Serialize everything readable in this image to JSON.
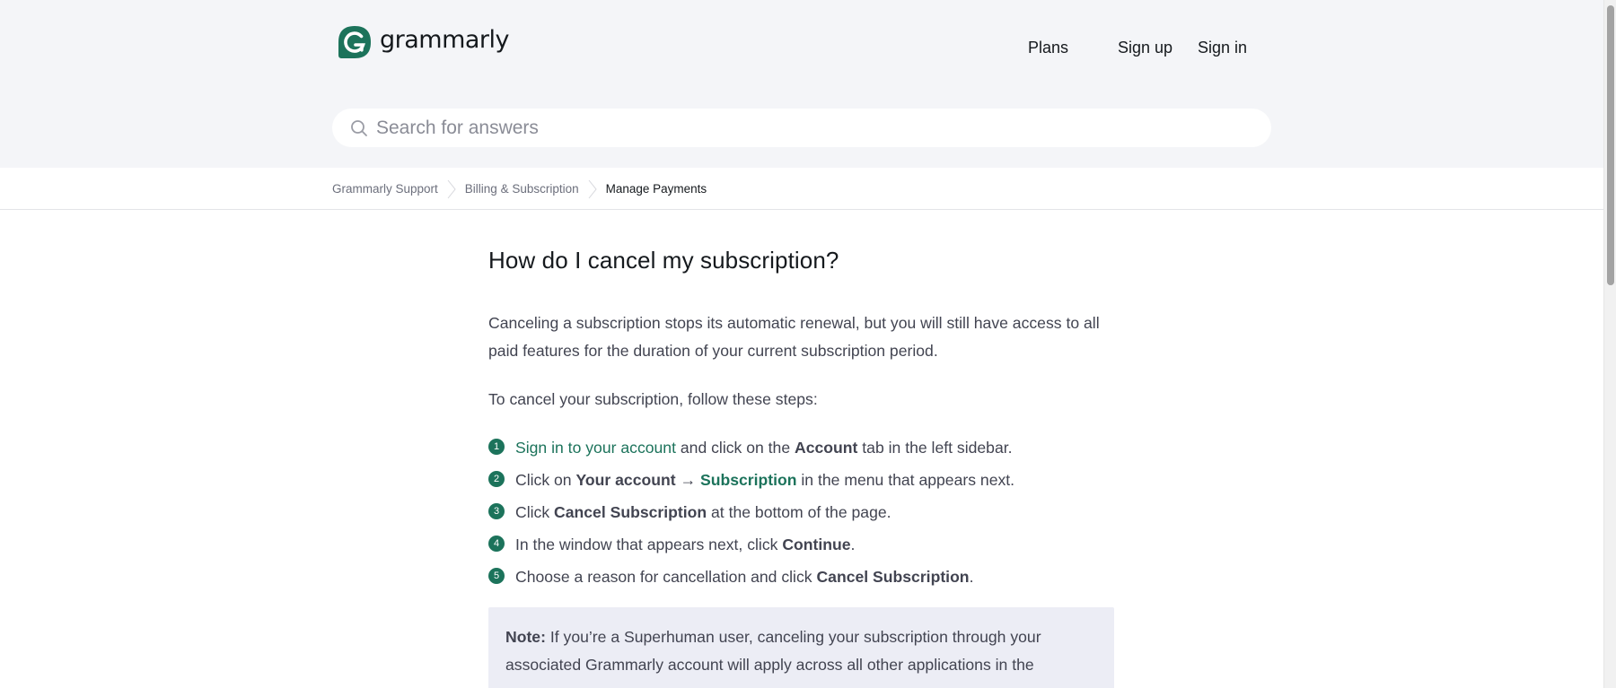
{
  "header": {
    "logo_text": "grammarly",
    "nav": {
      "plans": "Plans",
      "signup": "Sign up",
      "signin": "Sign in"
    }
  },
  "search": {
    "placeholder": "Search for answers",
    "value": ""
  },
  "breadcrumb": [
    "Grammarly Support",
    "Billing & Subscription",
    "Manage Payments"
  ],
  "article": {
    "title": "How do I cancel my subscription?",
    "intro_line1": "Canceling a subscription stops its automatic renewal, but you will still have access to all",
    "intro_line2": "paid features for the duration of your current subscription period.",
    "steps_intro": "To cancel your subscription, follow these steps:",
    "steps": [
      {
        "num": "1",
        "link": "Sign in to your account",
        "t1": " and click on the ",
        "b1": "Account",
        "t2": " tab in the left sidebar."
      },
      {
        "num": "2",
        "t1": "Click on ",
        "b1": "Your account",
        "arrow": " → ",
        "link": "Subscription",
        "t2": " in the menu that appears next."
      },
      {
        "num": "3",
        "t1": "Click ",
        "b1": "Cancel Subscription",
        "t2": " at the bottom of the page."
      },
      {
        "num": "4",
        "t1": "In the window that appears next, click ",
        "b1": "Continue",
        "t2": "."
      },
      {
        "num": "5",
        "t1": "Choose a reason for cancellation and click ",
        "b1": "Cancel Subscription",
        "t2": "."
      }
    ],
    "note": {
      "label": "Note:",
      "text_line1": " If you’re a Superhuman user, canceling your subscription through your",
      "text_line2": "associated Grammarly account will apply across all other applications in the"
    }
  },
  "colors": {
    "brand_green": "#1c735b",
    "header_bg": "#f4f5f8",
    "note_bg": "#ecedf5"
  }
}
